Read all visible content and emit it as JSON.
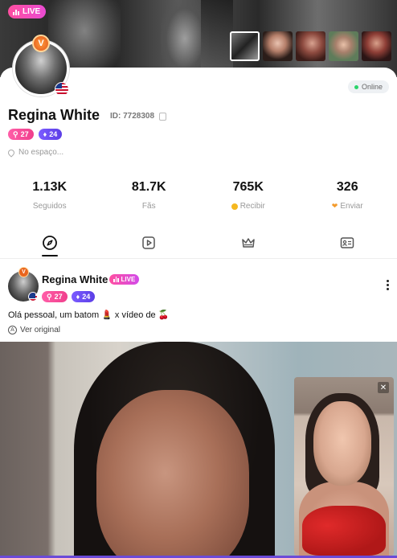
{
  "header": {
    "live_label": "LIVE"
  },
  "profile": {
    "name": "Regina White",
    "id_label": "ID: 7728308",
    "online_label": "Online",
    "level_a": "27",
    "level_b": "24",
    "location": "No espaço..."
  },
  "stats": [
    {
      "value": "1.13K",
      "label": "Seguidos"
    },
    {
      "value": "81.7K",
      "label": "Fãs"
    },
    {
      "value": "765K",
      "label": "Recibir"
    },
    {
      "value": "326",
      "label": "Enviar"
    }
  ],
  "tabs": [
    "moments",
    "videos",
    "crown",
    "profile-card"
  ],
  "post": {
    "author": "Regina White",
    "live_label": "LIVE",
    "level_a": "27",
    "level_b": "24",
    "caption": "Olá pessoal, um batom 💄 x vídeo de 🍒",
    "translate_label": "Ver original"
  },
  "colors": {
    "accent_pink": "#ff4fa0",
    "accent_purple": "#7b5cff",
    "online_green": "#2bd46b"
  }
}
